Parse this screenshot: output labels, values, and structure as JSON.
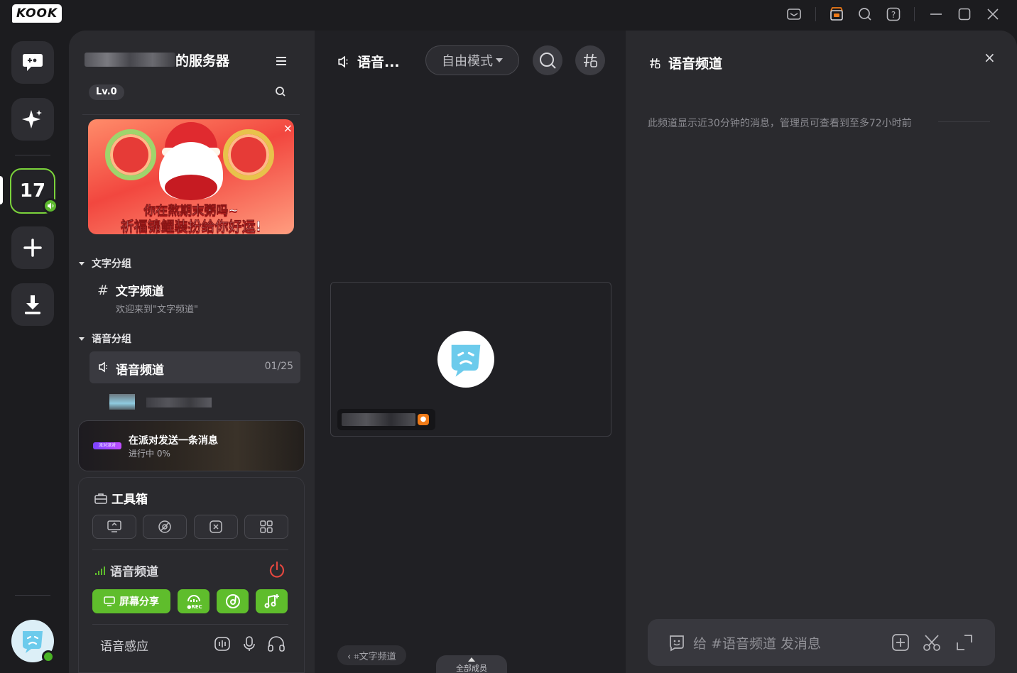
{
  "app": {
    "logo": "KOOK"
  },
  "rail": {
    "server_badge": "17"
  },
  "server": {
    "name_suffix": "的服务器",
    "level": "Lv.0"
  },
  "banner": {
    "line1": "你在熬期末粥吗~",
    "line2": "祈福锦鲤装扮给你好运!"
  },
  "groups": {
    "text_group": "文字分组",
    "text_channel": "文字频道",
    "text_channel_desc": "欢迎来到\"文字频道\"",
    "voice_group": "语音分组",
    "voice_channel": "语音频道",
    "voice_count": "01/25"
  },
  "party": {
    "tag": "派对派对",
    "title": "在派对发送一条消息",
    "progress": "进行中 0%"
  },
  "toolbox": {
    "title": "工具箱",
    "voice_label": "语音频道",
    "screen_share": "屏幕分享",
    "voice_activation": "语音感应"
  },
  "stage": {
    "title": "语音...",
    "mode": "自由模式",
    "back_chip": "‹ ⌗文字频道",
    "all_members": "全部成员"
  },
  "chat": {
    "title": "语音频道",
    "notice": "此频道显示近30分钟的消息，管理员可查看到至多72小时前",
    "placeholder": "给 #语音频道 发消息"
  },
  "colors": {
    "accent_green": "#5fbd2c",
    "online_green": "#49b324",
    "rail_active_border": "#7bd33b",
    "power_red": "#e0473f"
  }
}
